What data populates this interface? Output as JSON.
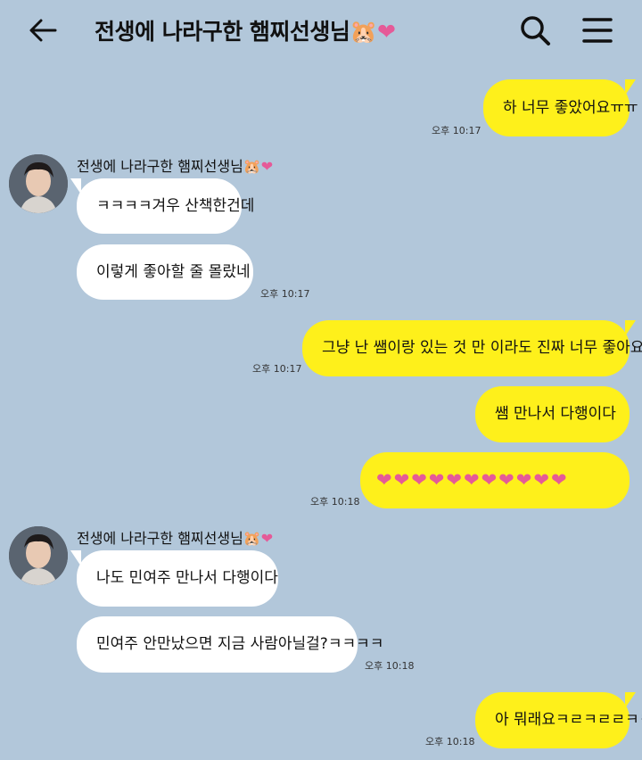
{
  "header": {
    "title": "전생에 나라구한 햄찌선생님🐹",
    "title_heart": "❤",
    "icons": [
      "back-arrow-icon",
      "search-icon",
      "menu-icon"
    ]
  },
  "colors": {
    "background": "#b2c7da",
    "my_bubble": "#fef01b",
    "their_bubble": "#ffffff",
    "heart": "#e55a98"
  },
  "messages": [
    {
      "text": "하 너무 좋았어요ㅠㅠ",
      "time": "오후 10:17"
    },
    {
      "sender": "전생에 나라구한 햄찌선생님🐹",
      "text": "ㅋㅋㅋㅋ겨우 산책한건데"
    },
    {
      "text": "이렇게 좋아할 줄 몰랐네",
      "time": "오후 10:17"
    },
    {
      "text": "그냥 난 쌤이랑 있는 것 만 이라도 진짜 너무 좋아요",
      "time": "오후 10:17"
    },
    {
      "text": "쌤 만나서 다행이다"
    },
    {
      "hearts": "❤❤❤❤❤❤❤❤❤❤❤",
      "time": "오후 10:18"
    },
    {
      "sender": "전생에 나라구한 햄찌선생님🐹",
      "text": "나도 민여주 만나서 다행이다"
    },
    {
      "text": "민여주 안만났으면 지금 사람아닐걸?ㅋㅋㅋㅋ",
      "time": "오후 10:18"
    },
    {
      "text": "아 뭐래요ㅋㄹㅋㄹㄹㅋㅋ",
      "time": "오후 10:18"
    }
  ],
  "heart_glyph": "❤"
}
